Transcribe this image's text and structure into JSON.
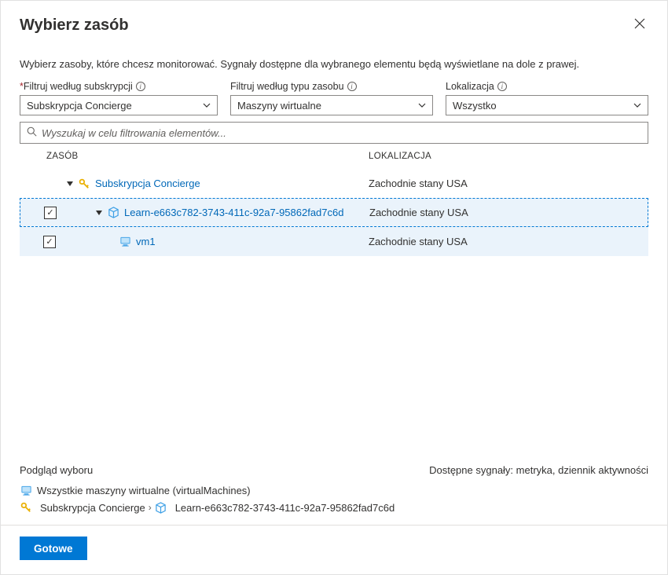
{
  "header": {
    "title": "Wybierz zasób"
  },
  "description": "Wybierz zasoby, które chcesz monitorować. Sygnały dostępne dla wybranego elementu będą wyświetlane na dole z prawej.",
  "filters": {
    "subscription": {
      "label": "Filtruj według subskrypcji",
      "value": "Subskrypcja Concierge"
    },
    "resourceType": {
      "label": "Filtruj według typu zasobu",
      "value": "Maszyny wirtualne"
    },
    "location": {
      "label": "Lokalizacja",
      "value": "Wszystko"
    }
  },
  "search": {
    "placeholder": "Wyszukaj w celu filtrowania elementów..."
  },
  "columns": {
    "resource": "ZASÓB",
    "location": "LOKALIZACJA"
  },
  "tree": {
    "subscription": {
      "name": "Subskrypcja Concierge",
      "location": "Zachodnie stany USA"
    },
    "resourceGroup": {
      "name": "Learn-e663c782-3743-411c-92a7-95862fad7c6d",
      "location": "Zachodnie stany USA"
    },
    "vm": {
      "name": "vm1",
      "location": "Zachodnie stany USA"
    }
  },
  "footer": {
    "previewLabel": "Podgląd wyboru",
    "signalsLabel": "Dostępne sygnały: metryka, dziennik aktywności",
    "allVms": "Wszystkie maszyny wirtualne (virtualMachines)",
    "breadcrumbSub": "Subskrypcja Concierge",
    "breadcrumbRg": "Learn-e663c782-3743-411c-92a7-95862fad7c6d",
    "doneButton": "Gotowe"
  }
}
